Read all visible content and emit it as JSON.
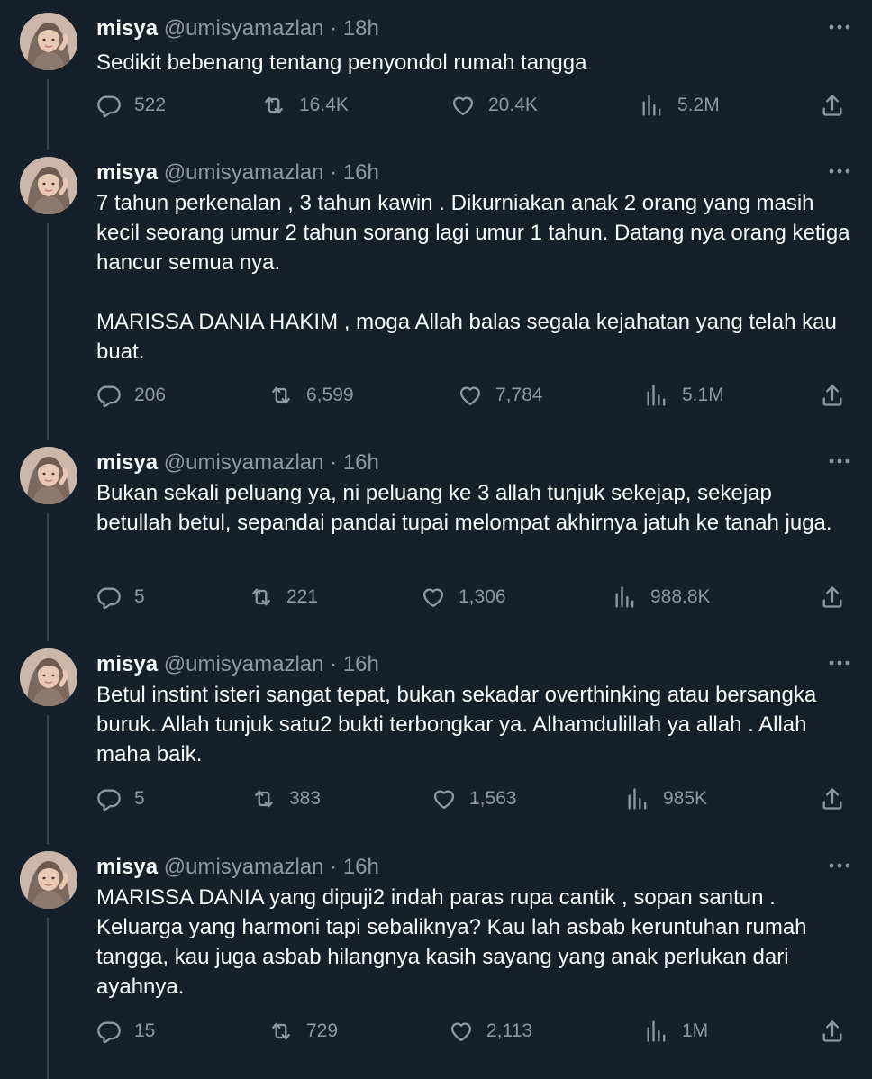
{
  "colors": {
    "background": "#15202b",
    "text": "#f7f9f9",
    "muted": "#8b98a5",
    "thread_line": "#38444d"
  },
  "tweets": [
    {
      "name": "misya",
      "handle": "@umisyamazlan",
      "separator": "·",
      "time": "18h",
      "text": "Sedikit bebenang tentang penyondol rumah tangga",
      "replies": "522",
      "retweets": "16.4K",
      "likes": "20.4K",
      "views": "5.2M"
    },
    {
      "name": "misya",
      "handle": "@umisyamazlan",
      "separator": "·",
      "time": "16h",
      "text": "7 tahun perkenalan , 3 tahun kawin . Dikurniakan anak 2 orang yang masih kecil seorang umur 2 tahun sorang lagi umur 1 tahun. Datang nya orang ketiga hancur semua nya.\n\nMARISSA DANIA HAKIM , moga Allah balas segala kejahatan yang telah kau buat.",
      "replies": "206",
      "retweets": "6,599",
      "likes": "7,784",
      "views": "5.1M"
    },
    {
      "name": "misya",
      "handle": "@umisyamazlan",
      "separator": "·",
      "time": "16h",
      "text": "Bukan sekali peluang ya, ni peluang ke 3 allah tunjuk sekejap, sekejap betullah betul, sepandai pandai tupai melompat akhirnya jatuh ke tanah juga.",
      "replies": "5",
      "retweets": "221",
      "likes": "1,306",
      "views": "988.8K"
    },
    {
      "name": "misya",
      "handle": "@umisyamazlan",
      "separator": "·",
      "time": "16h",
      "text": "Betul instint isteri sangat tepat, bukan sekadar overthinking atau bersangka buruk. Allah tunjuk satu2 bukti terbongkar ya. Alhamdulillah ya allah . Allah maha baik.",
      "replies": "5",
      "retweets": "383",
      "likes": "1,563",
      "views": "985K"
    },
    {
      "name": "misya",
      "handle": "@umisyamazlan",
      "separator": "·",
      "time": "16h",
      "text": "MARISSA DANIA yang dipuji2 indah paras rupa cantik , sopan santun . Keluarga yang harmoni tapi sebaliknya? Kau lah asbab keruntuhan rumah tangga, kau juga asbab hilangnya kasih sayang yang anak perlukan dari ayahnya.",
      "replies": "15",
      "retweets": "729",
      "likes": "2,113",
      "views": "1M"
    }
  ],
  "icons": {
    "reply": "reply-icon",
    "retweet": "retweet-icon",
    "like": "heart-icon",
    "views": "views-icon",
    "share": "share-icon",
    "more": "more-icon",
    "avatar": "avatar"
  }
}
